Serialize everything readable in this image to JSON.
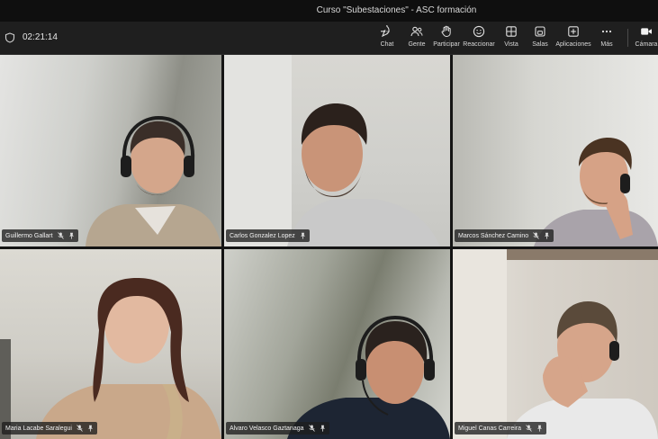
{
  "window": {
    "title": "Curso \"Subestaciones\" - ASC formación"
  },
  "meeting": {
    "timer": "02:21:14"
  },
  "toolbar": {
    "buttons": [
      {
        "label": "Chat",
        "icon": "chat-icon"
      },
      {
        "label": "Gente",
        "icon": "people-icon"
      },
      {
        "label": "Participar",
        "icon": "raise-hand-icon"
      },
      {
        "label": "Reaccionar",
        "icon": "emoji-icon"
      },
      {
        "label": "Vista",
        "icon": "grid-view-icon"
      },
      {
        "label": "Salas",
        "icon": "breakout-rooms-icon"
      },
      {
        "label": "Aplicaciones",
        "icon": "add-apps-icon"
      },
      {
        "label": "Más",
        "icon": "more-icon"
      },
      {
        "label": "Cámara",
        "icon": "camera-icon"
      }
    ]
  },
  "participants": [
    {
      "name": "Guillermo Gallart",
      "muted": true,
      "pinned": true
    },
    {
      "name": "Carlos Gonzalez Lopez",
      "muted": false,
      "pinned": true
    },
    {
      "name": "Marcos Sánchez Camino",
      "muted": true,
      "pinned": true
    },
    {
      "name": "Maria Lacabe Saralegui",
      "muted": true,
      "pinned": true
    },
    {
      "name": "Alvaro Velasco Gaztanaga",
      "muted": true,
      "pinned": true
    },
    {
      "name": "Miguel Canas Carreira",
      "muted": true,
      "pinned": true
    }
  ]
}
